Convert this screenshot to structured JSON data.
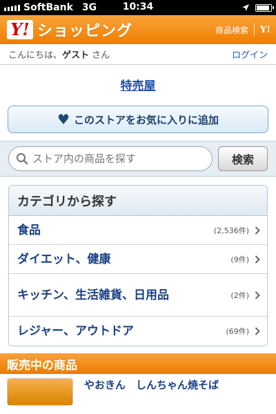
{
  "status_bar": {
    "carrier": "SoftBank",
    "network": "3G",
    "time": "10:34",
    "location_icon": "location-arrow-icon",
    "battery_level": 0.9
  },
  "header": {
    "logo_mark": "Y!",
    "logo_text": "ショッピング",
    "search_link": "商品検索",
    "yahoo_link": "Y!"
  },
  "greeting": {
    "prefix": "こんにちは、",
    "user": "ゲスト",
    "suffix": " さん",
    "login": "ログイン"
  },
  "store": {
    "name": "特売屋"
  },
  "favorite_button": {
    "label": "このストアをお気に入りに追加"
  },
  "search": {
    "placeholder": "ストア内の商品を探す",
    "button": "検索"
  },
  "categories": {
    "title": "カテゴリから探す",
    "items": [
      {
        "label": "食品",
        "count": "(2,536件)"
      },
      {
        "label": "ダイエット、健康",
        "count": "(9件)"
      },
      {
        "label": "キッチン、生活雑貨、日用品",
        "count": "(2件)"
      },
      {
        "label": "レジャー、アウトドア",
        "count": "(69件)"
      }
    ]
  },
  "selling": {
    "title": "販売中の商品",
    "first_product": "やおきん　しんちゃん焼そば"
  },
  "colors": {
    "brand_orange": "#ef7d00",
    "link_blue": "#1a3f84"
  }
}
